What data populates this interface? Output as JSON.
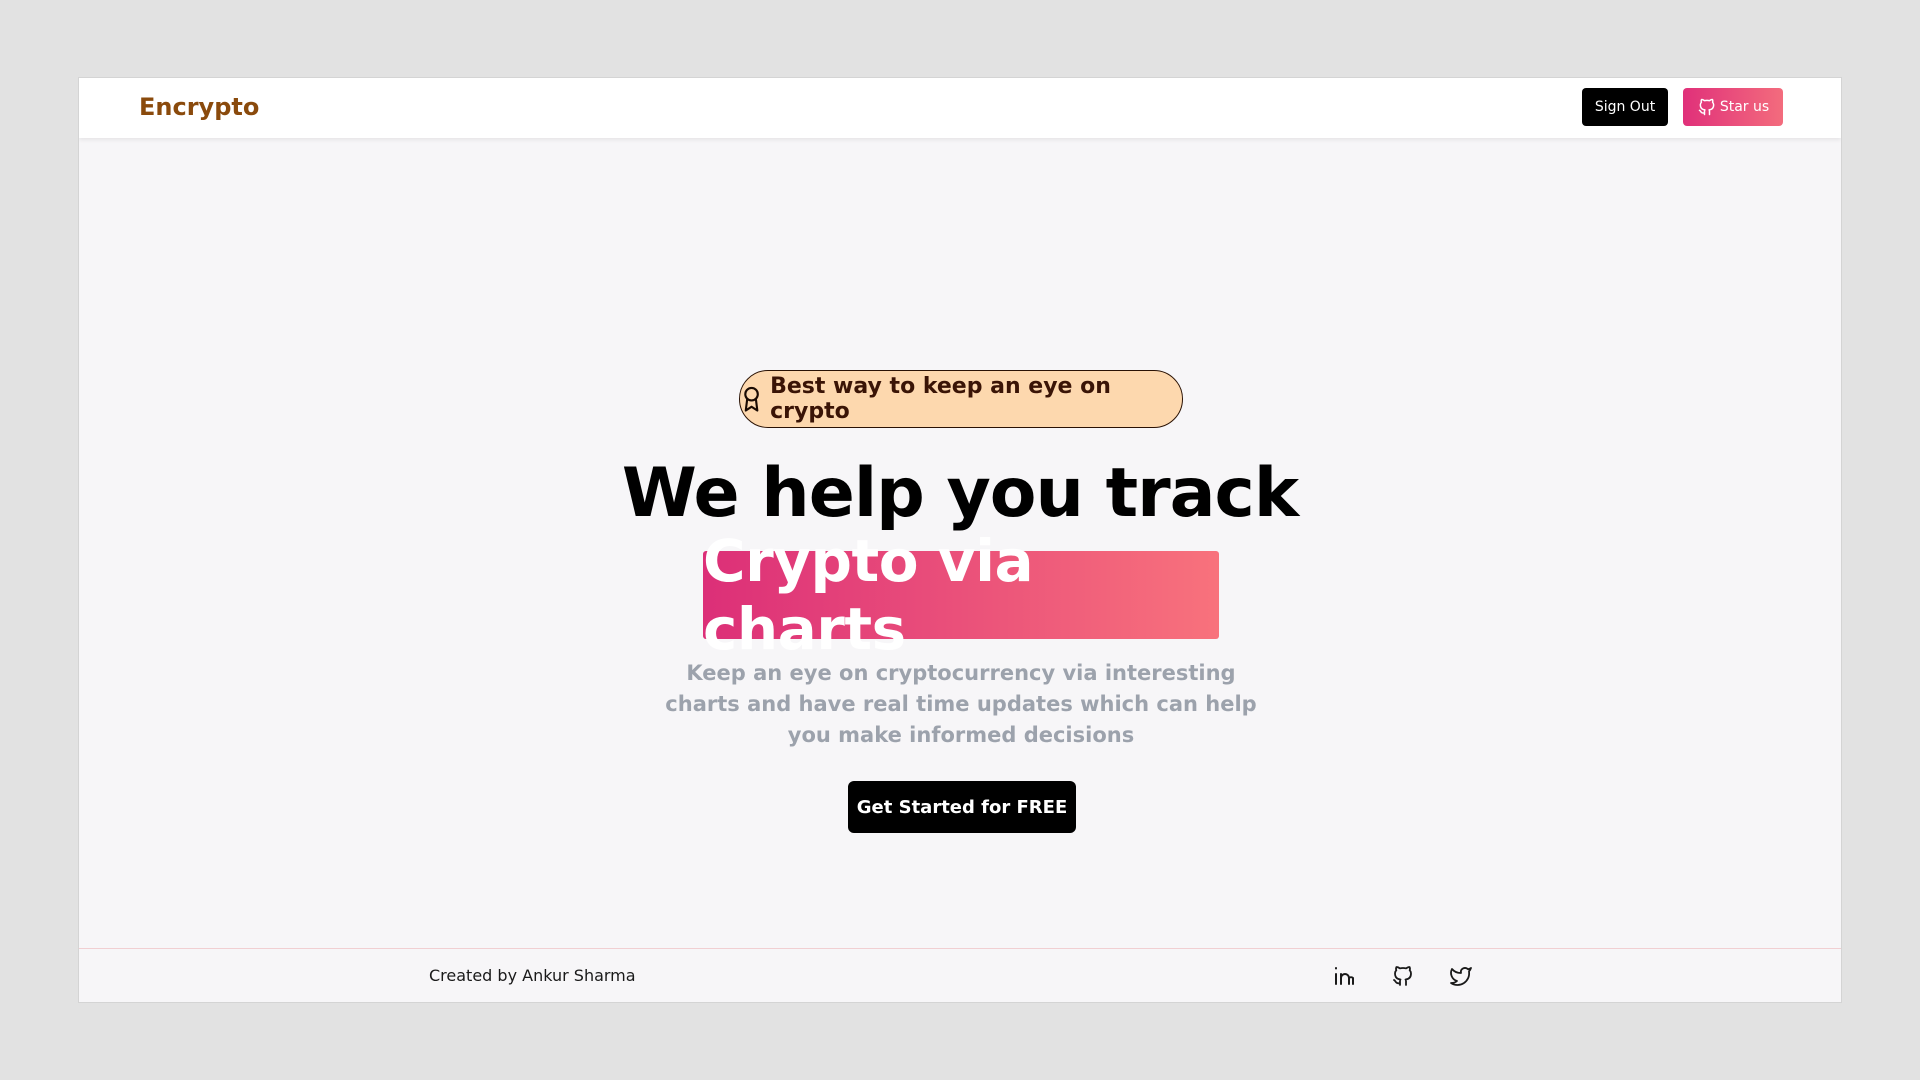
{
  "header": {
    "brand": "Encrypto",
    "sign_out_label": "Sign Out",
    "star_label": "Star us"
  },
  "hero": {
    "badge_text": "Best way to keep an eye on crypto",
    "headline": "We help you track",
    "highlight": "Crypto via charts",
    "subtext": "Keep an eye on cryptocurrency via interesting charts and have real time updates which can help you make informed decisions",
    "cta_label": "Get Started for FREE"
  },
  "footer": {
    "credit": "Created by Ankur Sharma",
    "social_icons": [
      "linkedin-icon",
      "github-icon",
      "twitter-icon"
    ]
  },
  "colors": {
    "brand": "#8a4a0c",
    "accent_gradient_start": "#dc2f78",
    "accent_gradient_end": "#f8727c",
    "badge_bg": "#fdd8ae",
    "subtext": "#9ca2ac"
  }
}
